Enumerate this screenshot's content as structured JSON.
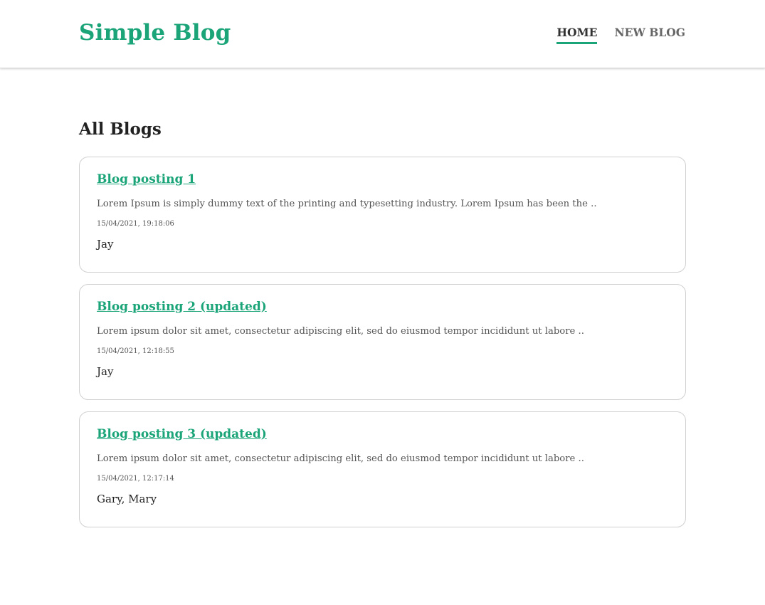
{
  "header": {
    "brand": "Simple Blog",
    "nav": {
      "home_label": "HOME",
      "new_blog_label": "NEW BLOG"
    }
  },
  "main": {
    "title": "All Blogs",
    "blogs": [
      {
        "title": "Blog posting 1",
        "snippet": "Lorem Ipsum is simply dummy text of the printing and typesetting industry. Lorem Ipsum has been the ..",
        "date": "15/04/2021, 19:18:06",
        "author": "Jay"
      },
      {
        "title": "Blog posting 2 (updated)",
        "snippet": "Lorem ipsum dolor sit amet, consectetur adipiscing elit, sed do eiusmod tempor incididunt ut labore ..",
        "date": "15/04/2021, 12:18:55",
        "author": "Jay"
      },
      {
        "title": "Blog posting 3 (updated)",
        "snippet": "Lorem ipsum dolor sit amet, consectetur adipiscing elit, sed do eiusmod tempor incididunt ut labore ..",
        "date": "15/04/2021, 12:17:14",
        "author": "Gary, Mary"
      }
    ]
  },
  "colors": {
    "brand": "#1aa478",
    "text": "#222222",
    "muted": "#555555",
    "border": "#d0d0d0"
  }
}
